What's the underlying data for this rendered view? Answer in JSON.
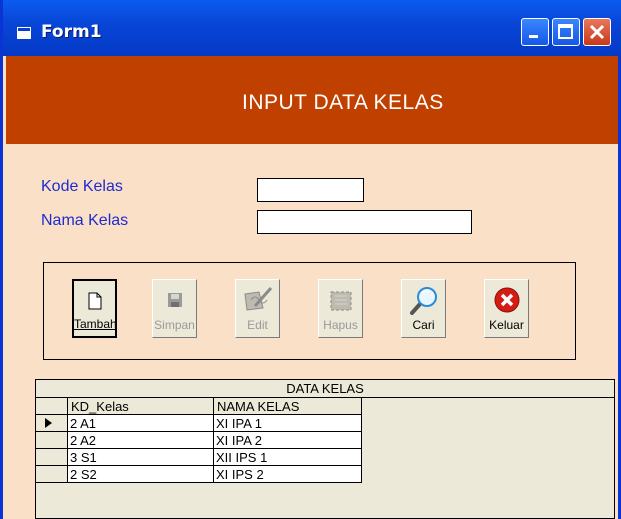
{
  "window": {
    "title": "Form1"
  },
  "header": {
    "title": "INPUT DATA KELAS"
  },
  "form": {
    "kode_label": "Kode Kelas",
    "kode_value": "",
    "nama_label": "Nama Kelas",
    "nama_value": ""
  },
  "toolbar": {
    "tambah": "Tambah",
    "simpan": "Simpan",
    "edit": "Edit",
    "hapus": "Hapus",
    "cari": "Cari",
    "keluar": "Keluar"
  },
  "grid": {
    "caption": "DATA KELAS",
    "columns": [
      "KD_Kelas",
      "NAMA KELAS"
    ],
    "rows": [
      [
        "2 A1",
        "XI IPA 1"
      ],
      [
        "2 A2",
        "XI IPA 2"
      ],
      [
        "3 S1",
        "XII IPS 1"
      ],
      [
        "2 S2",
        "XI IPS 2"
      ]
    ]
  }
}
